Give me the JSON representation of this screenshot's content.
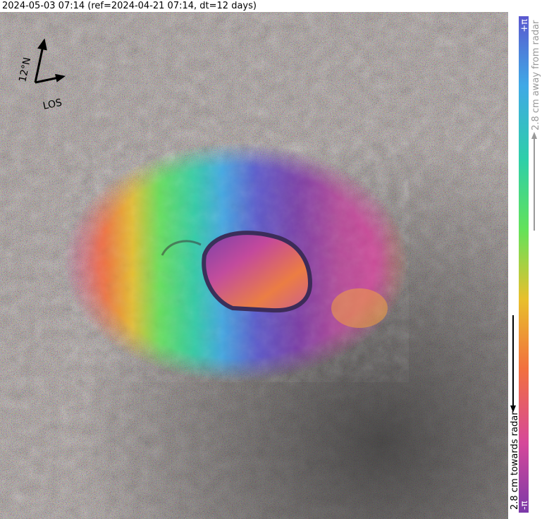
{
  "header": {
    "title": "2024-05-03 07:14 (ref=2024-04-21 07:14, dt=12 days)"
  },
  "compass": {
    "north_label": "12°N",
    "los_label": "LOS",
    "icon": "north-arrow-icon"
  },
  "colorbar": {
    "top_label": "+π",
    "bottom_label": "-π",
    "away_label": "2.8 cm away from radar",
    "towards_label": "2.8 cm towards radar",
    "colors": [
      "#7b3aa8",
      "#d6489a",
      "#f2703e",
      "#e8c02c",
      "#63e25a",
      "#2ecfa8",
      "#3fa9e6",
      "#5a58cf"
    ]
  }
}
